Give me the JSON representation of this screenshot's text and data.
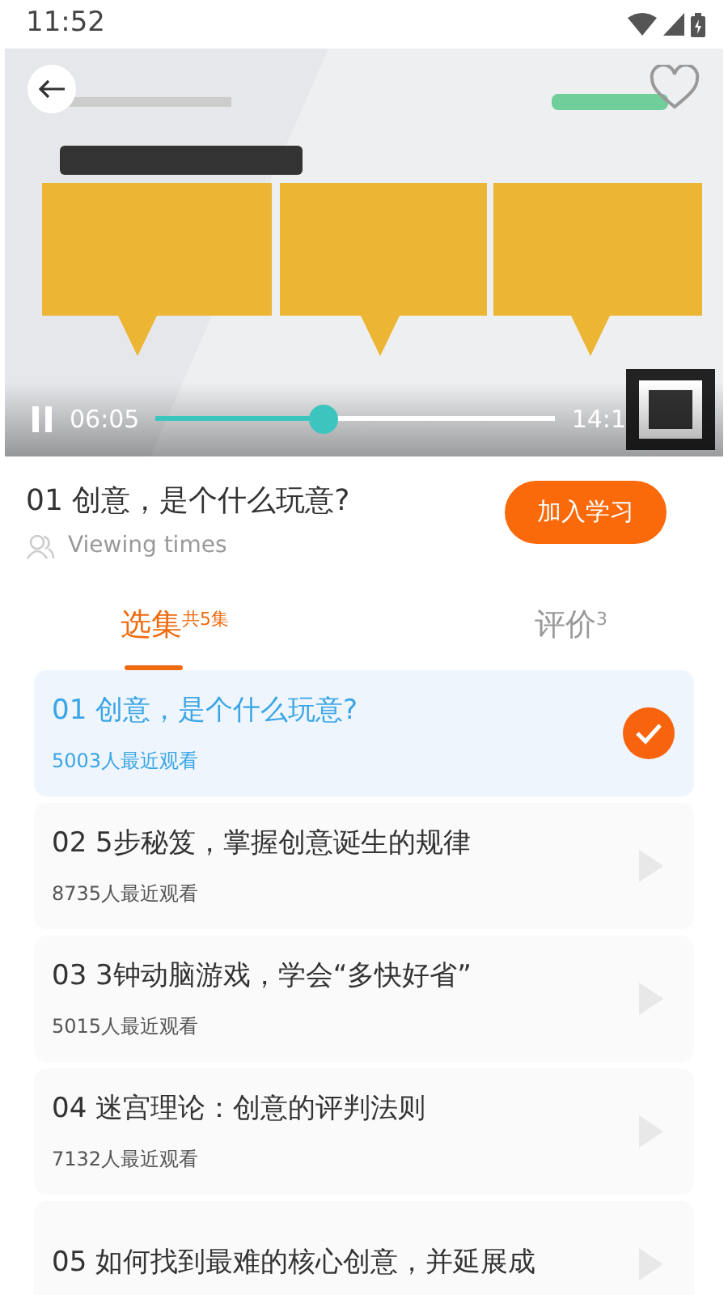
{
  "status_bar": {
    "time": "11:52"
  },
  "player": {
    "playing": true,
    "current_time": "06:05",
    "total_time": "14:1",
    "level": 0.42
  },
  "course": {
    "title": "01 创意，是个什么玩意?",
    "meta": "Viewing times",
    "join_button": "加入学习"
  },
  "tabs": [
    {
      "label": "选集",
      "count": "共5集",
      "selected": true
    },
    {
      "label": "评价",
      "count": "3",
      "selected": false
    }
  ],
  "episodes": [
    {
      "title": "01 创意，是个什么玩意?",
      "viewers": "5003人最近观看",
      "selected": true
    },
    {
      "title": "02 5步秘笈，掌握创意诞生的规律",
      "viewers": "8735人最近观看",
      "selected": false
    },
    {
      "title": "03 3钟动脑游戏，学会“多快好省”",
      "viewers": "5015人最近观看",
      "selected": false
    },
    {
      "title": "04 迷宫理论：创意的评判法则",
      "viewers": "7132人最近观看",
      "selected": false
    },
    {
      "title": "05 如何找到最难的核心创意，并延展成",
      "selected": false
    }
  ]
}
